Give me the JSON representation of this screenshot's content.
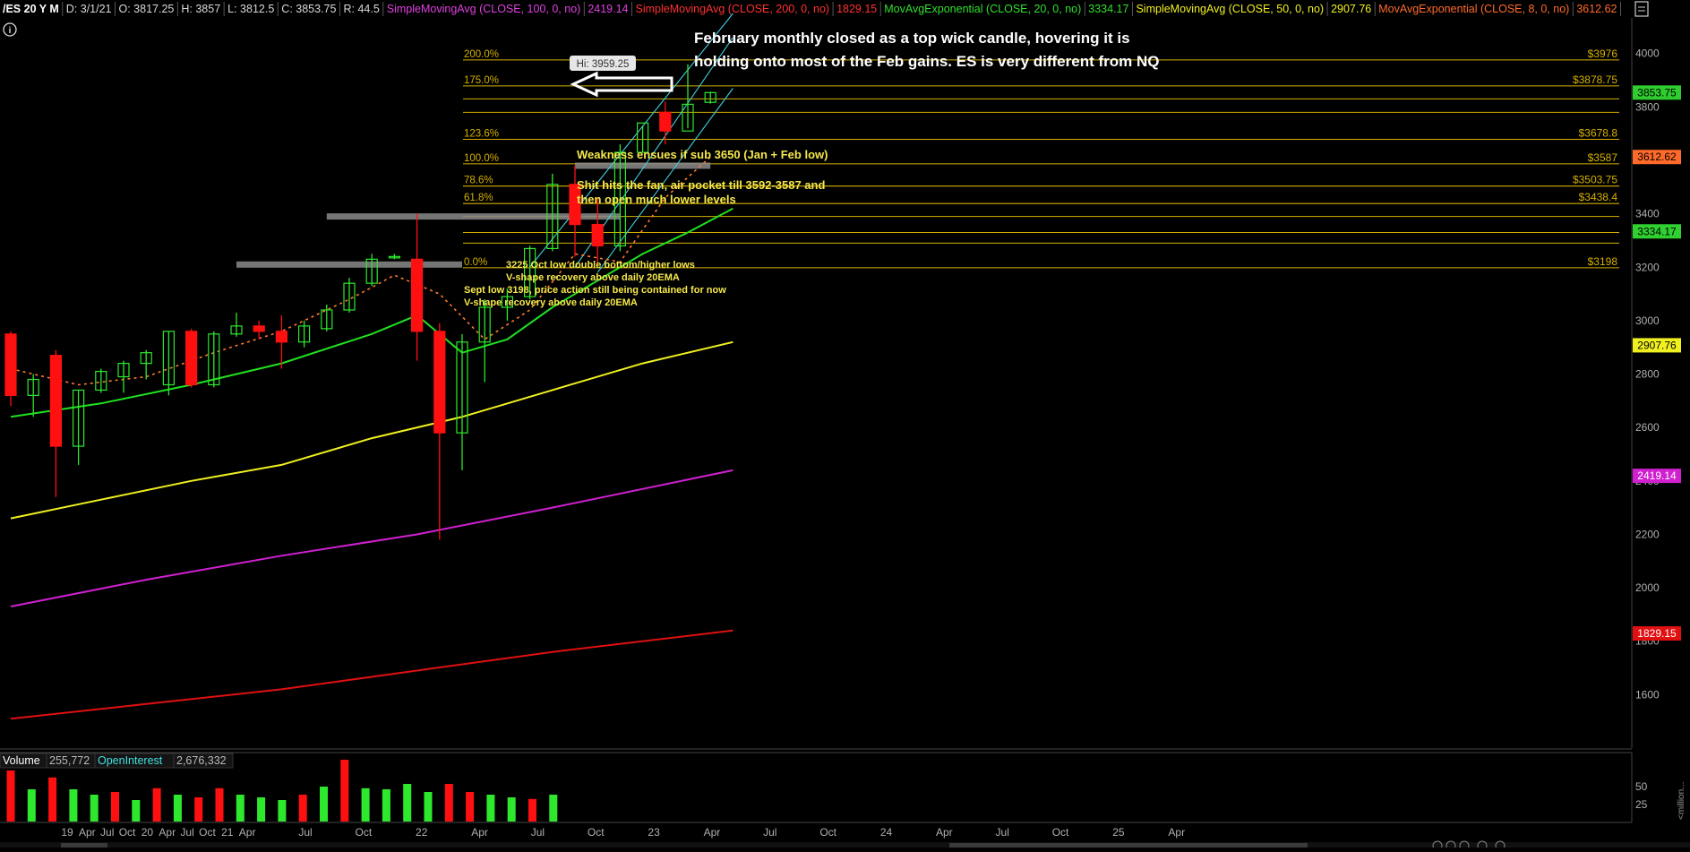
{
  "header": {
    "items": [
      {
        "text": "/ES 20 Y M",
        "color": "#ffffff",
        "bold": true
      },
      {
        "text": "D: 3/1/21",
        "color": "#d8d8d8"
      },
      {
        "text": "O: 3817.25",
        "color": "#d8d8d8"
      },
      {
        "text": "H: 3857",
        "color": "#d8d8d8"
      },
      {
        "text": "L: 3812.5",
        "color": "#d8d8d8"
      },
      {
        "text": "C: 3853.75",
        "color": "#d8d8d8"
      },
      {
        "text": "R: 44.5",
        "color": "#d8d8d8"
      },
      {
        "text": "SimpleMovingAvg (CLOSE, 100, 0, no)",
        "color": "#e040e0"
      },
      {
        "text": "2419.14",
        "color": "#e040e0"
      },
      {
        "text": "SimpleMovingAvg (CLOSE, 200, 0, no)",
        "color": "#ff3030"
      },
      {
        "text": "1829.15",
        "color": "#ff3030"
      },
      {
        "text": "MovAvgExponential (CLOSE, 20, 0, no)",
        "color": "#30e030"
      },
      {
        "text": "3334.17",
        "color": "#30e030"
      },
      {
        "text": "SimpleMovingAvg (CLOSE, 50, 0, no)",
        "color": "#f0f020"
      },
      {
        "text": "2907.76",
        "color": "#f0f020"
      },
      {
        "text": "MovAvgExponential (CLOSE, 8, 0, no)",
        "color": "#ff6a2a"
      },
      {
        "text": "3612.62",
        "color": "#ff6a2a"
      }
    ],
    "info_icon": "i"
  },
  "colors": {
    "up": "#2ee82e",
    "down": "#ff1010",
    "fib": "#d4b000",
    "grid_text": "#b0b0b0",
    "sma100": "#d020d0",
    "sma200": "#e01010",
    "ema20": "#20e020",
    "sma50": "#f0f020",
    "ema8": "#ff7a30",
    "fan": "#40d0e0",
    "note": "#f5e84a"
  },
  "chart_data": {
    "type": "candlestick",
    "symbol": "/ES",
    "timeframe": "M",
    "ylim": [
      1400,
      4150
    ],
    "y_ticks": [
      1600,
      1800,
      2000,
      2200,
      2400,
      2600,
      2800,
      3000,
      3200,
      3400,
      3800,
      4000
    ],
    "x_labels": [
      "19",
      "Apr",
      "Jul",
      "Oct",
      "20",
      "Apr",
      "Jul",
      "Oct",
      "21",
      "Apr",
      "Jul",
      "Oct",
      "22",
      "Apr",
      "Jul",
      "Oct",
      "23",
      "Apr",
      "Jul",
      "Oct",
      "24",
      "Apr",
      "Jul",
      "Oct",
      "25",
      "Apr"
    ],
    "candles": [
      {
        "o": 2950,
        "h": 2960,
        "l": 2680,
        "c": 2720
      },
      {
        "o": 2720,
        "h": 2800,
        "l": 2640,
        "c": 2780
      },
      {
        "o": 2870,
        "h": 2890,
        "l": 2340,
        "c": 2530
      },
      {
        "o": 2530,
        "h": 2740,
        "l": 2460,
        "c": 2740
      },
      {
        "o": 2740,
        "h": 2820,
        "l": 2730,
        "c": 2810
      },
      {
        "o": 2790,
        "h": 2850,
        "l": 2730,
        "c": 2840
      },
      {
        "o": 2840,
        "h": 2890,
        "l": 2780,
        "c": 2880
      },
      {
        "o": 2760,
        "h": 2960,
        "l": 2720,
        "c": 2960
      },
      {
        "o": 2960,
        "h": 2970,
        "l": 2750,
        "c": 2760
      },
      {
        "o": 2760,
        "h": 2960,
        "l": 2750,
        "c": 2950
      },
      {
        "o": 2950,
        "h": 3030,
        "l": 2940,
        "c": 2980
      },
      {
        "o": 2980,
        "h": 3000,
        "l": 2930,
        "c": 2960
      },
      {
        "o": 2960,
        "h": 3020,
        "l": 2820,
        "c": 2920
      },
      {
        "o": 2920,
        "h": 3000,
        "l": 2900,
        "c": 2980
      },
      {
        "o": 2970,
        "h": 3060,
        "l": 2960,
        "c": 3040
      },
      {
        "o": 3040,
        "h": 3160,
        "l": 3030,
        "c": 3140
      },
      {
        "o": 3140,
        "h": 3250,
        "l": 3130,
        "c": 3230
      },
      {
        "o": 3240,
        "h": 3250,
        "l": 3230,
        "c": 3240
      },
      {
        "o": 3230,
        "h": 3400,
        "l": 2850,
        "c": 2960
      },
      {
        "o": 2960,
        "h": 2990,
        "l": 2180,
        "c": 2580
      },
      {
        "o": 2580,
        "h": 2950,
        "l": 2440,
        "c": 2920
      },
      {
        "o": 2920,
        "h": 3080,
        "l": 2770,
        "c": 3050
      },
      {
        "o": 3050,
        "h": 3120,
        "l": 3000,
        "c": 3090
      },
      {
        "o": 3090,
        "h": 3280,
        "l": 3080,
        "c": 3270
      },
      {
        "o": 3270,
        "h": 3550,
        "l": 3260,
        "c": 3510
      },
      {
        "o": 3510,
        "h": 3580,
        "l": 3240,
        "c": 3360
      },
      {
        "o": 3360,
        "h": 3460,
        "l": 3210,
        "c": 3280
      },
      {
        "o": 3280,
        "h": 3660,
        "l": 3260,
        "c": 3630
      },
      {
        "o": 3630,
        "h": 3730,
        "l": 3630,
        "c": 3740
      },
      {
        "o": 3780,
        "h": 3820,
        "l": 3660,
        "c": 3710
      },
      {
        "o": 3710,
        "h": 3960,
        "l": 3720,
        "c": 3810
      },
      {
        "o": 3817.25,
        "h": 3857,
        "l": 3812.5,
        "c": 3853.75
      }
    ],
    "volume": [
      {
        "v": 0.95,
        "up": false
      },
      {
        "v": 0.6,
        "up": true
      },
      {
        "v": 0.82,
        "up": false
      },
      {
        "v": 0.6,
        "up": true
      },
      {
        "v": 0.5,
        "up": true
      },
      {
        "v": 0.55,
        "up": false
      },
      {
        "v": 0.4,
        "up": true
      },
      {
        "v": 0.62,
        "up": false
      },
      {
        "v": 0.5,
        "up": true
      },
      {
        "v": 0.45,
        "up": false
      },
      {
        "v": 0.62,
        "up": false
      },
      {
        "v": 0.5,
        "up": true
      },
      {
        "v": 0.45,
        "up": true
      },
      {
        "v": 0.4,
        "up": true
      },
      {
        "v": 0.5,
        "up": false
      },
      {
        "v": 0.65,
        "up": true
      },
      {
        "v": 1.15,
        "up": false
      },
      {
        "v": 0.62,
        "up": true
      },
      {
        "v": 0.6,
        "up": true
      },
      {
        "v": 0.7,
        "up": true
      },
      {
        "v": 0.55,
        "up": true
      },
      {
        "v": 0.7,
        "up": false
      },
      {
        "v": 0.55,
        "up": false
      },
      {
        "v": 0.5,
        "up": true
      },
      {
        "v": 0.45,
        "up": true
      },
      {
        "v": 0.42,
        "up": false
      },
      {
        "v": 0.5,
        "up": true
      }
    ],
    "volume_ticks": [
      "50",
      "25"
    ],
    "moving_averages": {
      "sma200": [
        [
          0,
          1510
        ],
        [
          6,
          1565
        ],
        [
          12,
          1620
        ],
        [
          18,
          1690
        ],
        [
          24,
          1760
        ],
        [
          32,
          1840
        ]
      ],
      "sma100": [
        [
          0,
          1930
        ],
        [
          6,
          2030
        ],
        [
          12,
          2120
        ],
        [
          18,
          2200
        ],
        [
          24,
          2300
        ],
        [
          32,
          2440
        ]
      ],
      "sma50": [
        [
          0,
          2260
        ],
        [
          4,
          2330
        ],
        [
          8,
          2400
        ],
        [
          12,
          2460
        ],
        [
          16,
          2560
        ],
        [
          20,
          2640
        ],
        [
          24,
          2740
        ],
        [
          28,
          2840
        ],
        [
          32,
          2920
        ]
      ],
      "ema20": [
        [
          0,
          2640
        ],
        [
          4,
          2690
        ],
        [
          8,
          2760
        ],
        [
          12,
          2840
        ],
        [
          16,
          2950
        ],
        [
          18,
          3020
        ],
        [
          20,
          2880
        ],
        [
          22,
          2930
        ],
        [
          24,
          3050
        ],
        [
          26,
          3150
        ],
        [
          28,
          3250
        ],
        [
          30,
          3330
        ],
        [
          32,
          3420
        ]
      ],
      "ema8": [
        [
          0,
          2820
        ],
        [
          3,
          2760
        ],
        [
          6,
          2790
        ],
        [
          9,
          2880
        ],
        [
          12,
          2960
        ],
        [
          15,
          3080
        ],
        [
          17,
          3170
        ],
        [
          19,
          3100
        ],
        [
          21,
          2930
        ],
        [
          23,
          3040
        ],
        [
          25,
          3250
        ],
        [
          27,
          3220
        ],
        [
          29,
          3460
        ],
        [
          31,
          3612.62
        ]
      ]
    },
    "fib_levels": [
      {
        "pct": "200.0%",
        "price": 3976,
        "label": "$3976"
      },
      {
        "pct": "175.0%",
        "price": 3878.75,
        "label": "$3878.75"
      },
      {
        "pct": "123.6%",
        "price": 3678.8,
        "label": "$3678.8"
      },
      {
        "pct": "100.0%",
        "price": 3587,
        "label": "$3587"
      },
      {
        "pct": "78.6%",
        "price": 3503.75,
        "label": "$3503.75"
      },
      {
        "pct": "61.8%",
        "price": 3438.4,
        "label": "$3438.4"
      },
      {
        "pct": "0.0%",
        "price": 3198,
        "label": "$3198"
      }
    ],
    "extra_levels": [
      3830,
      3780,
      3390,
      3330,
      3290
    ],
    "price_tags": [
      {
        "label": "3853.75",
        "price": 3853.75,
        "bg": "#2ecc2e",
        "fg": "#000000"
      },
      {
        "label": "3612.62",
        "price": 3612.62,
        "bg": "#ff6a2a",
        "fg": "#000000"
      },
      {
        "label": "3334.17",
        "price": 3334.17,
        "bg": "#30d030",
        "fg": "#000000"
      },
      {
        "label": "2907.76",
        "price": 2907.76,
        "bg": "#f0f020",
        "fg": "#000000"
      },
      {
        "label": "2419.14",
        "price": 2419.14,
        "bg": "#d020d0",
        "fg": "#ffffff"
      },
      {
        "label": "1829.15",
        "price": 1829.15,
        "bg": "#e01010",
        "fg": "#ffffff"
      }
    ],
    "high_label": "Hi: 3959.25",
    "gray_zones": [
      {
        "from": 10,
        "to": 20,
        "price": 3210
      },
      {
        "from": 14,
        "to": 27,
        "price": 3390
      },
      {
        "from": 25,
        "to": 31,
        "price": 3580
      }
    ],
    "annotations": {
      "headline_line1": "February monthly closed as a top wick candle, hovering it is",
      "headline_line2": "holding onto most of the Feb gains. ES is very different from NQ",
      "weakness": "Weakness ensues if sub 3650 (Jan + Feb low)",
      "fan_line1": "Shit hits the fan, air pocket till 3592-3587 and",
      "fan_line2": "then open much lower levels",
      "oct_low_line1": "3225 Oct low double bottom/higher lows",
      "oct_low_line2": "V-shape recovery above daily 20EMA",
      "sept_low_line1": "Sept low 3198, price action still being contained for now",
      "sept_low_line2": "V-shape recovery above daily 20EMA"
    }
  },
  "volume_panel": {
    "title": "Volume",
    "value": "255,772",
    "oi_label": "OpenInterest",
    "oi_value": "2,676,332",
    "axis_unit": "<million..."
  }
}
